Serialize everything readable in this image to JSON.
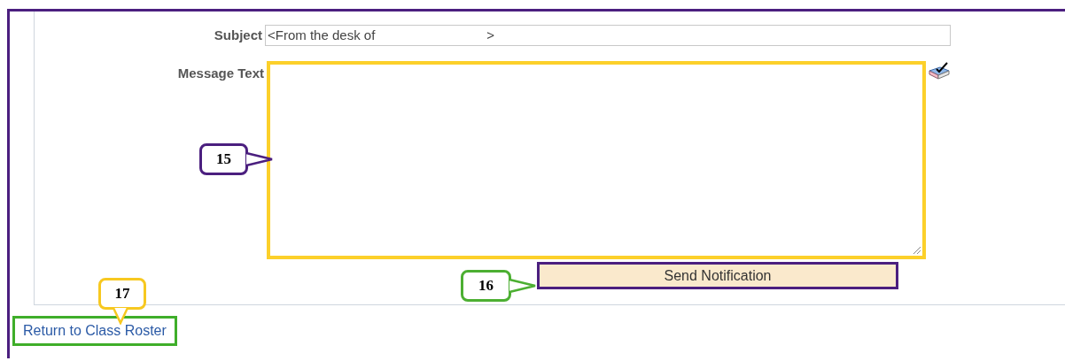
{
  "subject": {
    "label": "Subject",
    "value": "<From the desk of",
    "value_end": ">"
  },
  "message": {
    "label": "Message Text"
  },
  "send_button": "Send Notification",
  "return_link": "Return to Class Roster",
  "callouts": [
    {
      "number": "15",
      "color": "#4b1f7f",
      "kind": "left"
    },
    {
      "number": "16",
      "color": "#4caf32",
      "kind": "left"
    },
    {
      "number": "17",
      "color": "#f7c820",
      "kind": "down"
    }
  ]
}
